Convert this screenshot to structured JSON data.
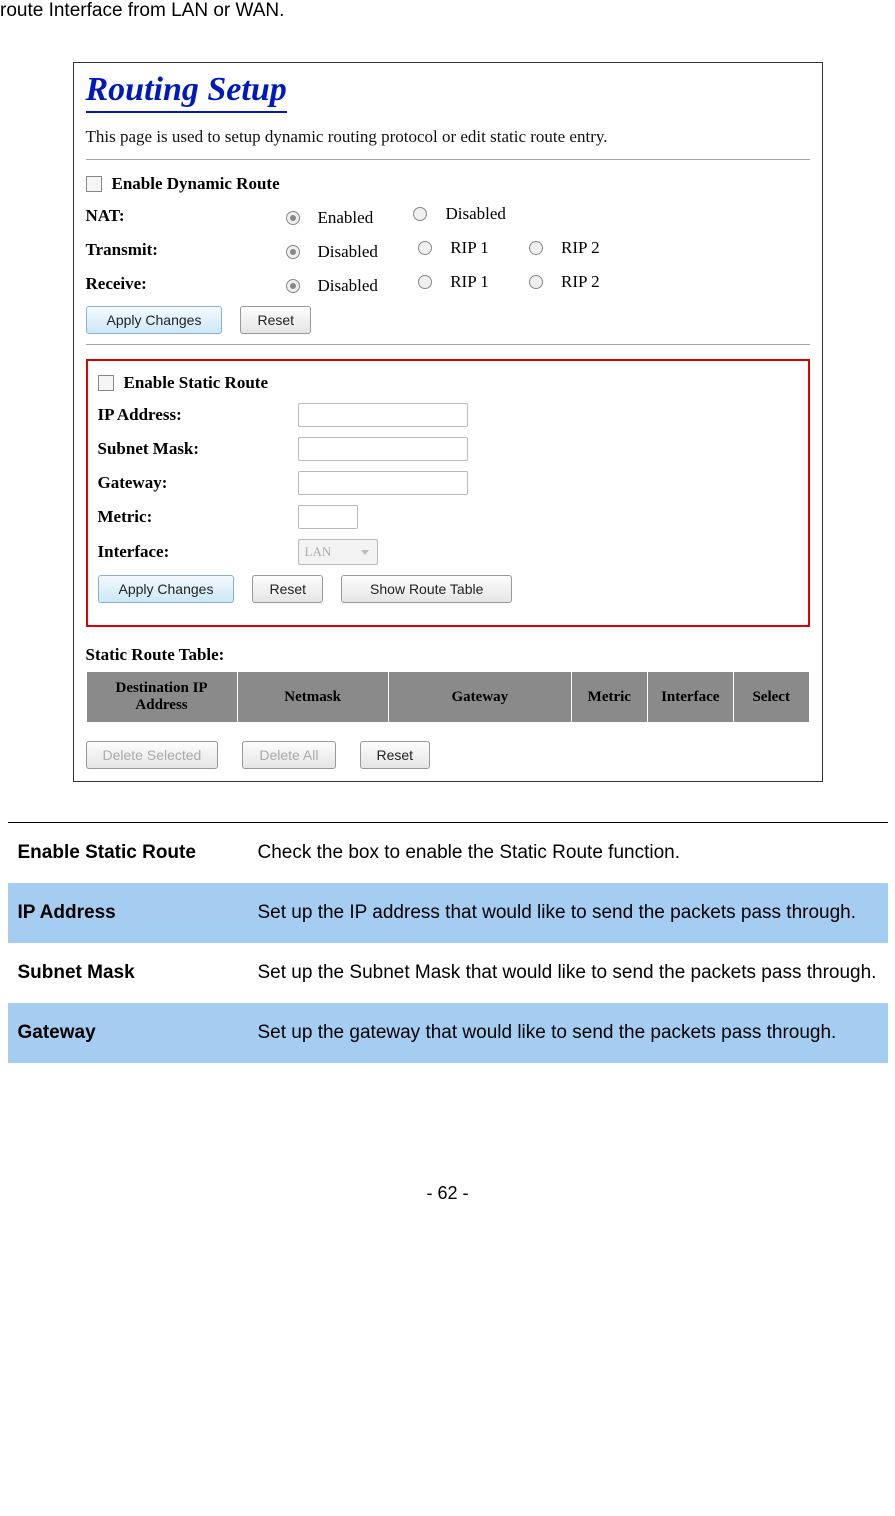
{
  "intro": "route Interface from LAN or WAN.",
  "screenshot": {
    "title": "Routing Setup",
    "desc": "This page is used to setup dynamic routing protocol or edit static route entry.",
    "dynamic": {
      "enable_label": "Enable Dynamic Route",
      "nat_label": "NAT:",
      "nat_enabled": "Enabled",
      "nat_disabled": "Disabled",
      "transmit_label": "Transmit:",
      "receive_label": "Receive:",
      "opt_disabled": "Disabled",
      "opt_rip1": "RIP 1",
      "opt_rip2": "RIP 2"
    },
    "apply_changes": "Apply Changes",
    "reset": "Reset",
    "static": {
      "enable_label": "Enable Static Route",
      "ip_label": "IP Address:",
      "subnet_label": "Subnet Mask:",
      "gateway_label": "Gateway:",
      "metric_label": "Metric:",
      "interface_label": "Interface:",
      "interface_value": "LAN",
      "show_route": "Show Route Table"
    },
    "table": {
      "label": "Static Route Table:",
      "h1": "Destination IP Address",
      "h2": "Netmask",
      "h3": "Gateway",
      "h4": "Metric",
      "h5": "Interface",
      "h6": "Select"
    },
    "delete_selected": "Delete Selected",
    "delete_all": "Delete All"
  },
  "definitions": {
    "r1_term": "Enable Static Route",
    "r1_desc": "Check the box to enable the Static Route function.",
    "r2_term": "IP Address",
    "r2_desc": "Set up the IP address that would like to send the packets pass through.",
    "r3_term": "Subnet Mask",
    "r3_desc": "Set up the Subnet Mask that would like to send the packets pass through.",
    "r4_term": "Gateway",
    "r4_desc": "Set up the gateway that would like to send the packets pass through."
  },
  "page_num": "- 62 -"
}
